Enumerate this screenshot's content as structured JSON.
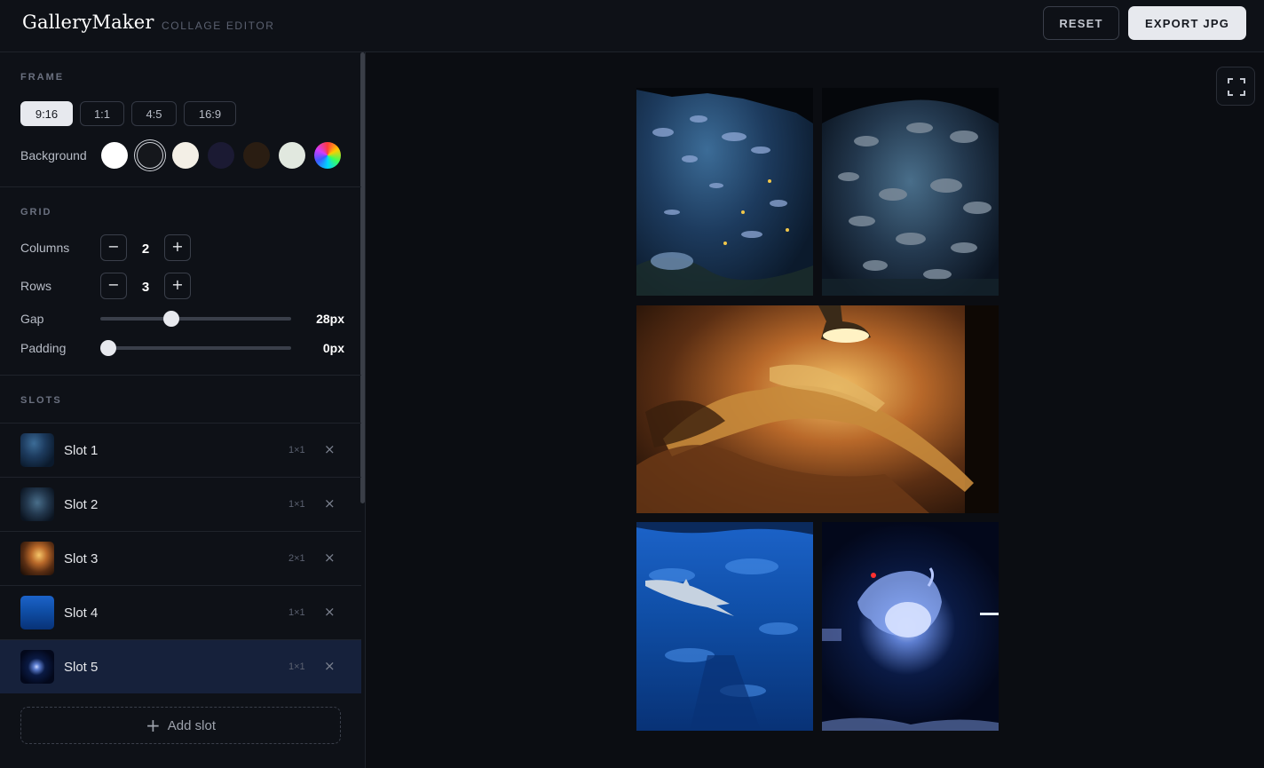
{
  "app": {
    "name": "GalleryMaker",
    "subtitle": "COLLAGE EDITOR",
    "reset_label": "RESET",
    "export_label": "EXPORT JPG"
  },
  "frame": {
    "title": "FRAME",
    "ratios": [
      "9:16",
      "1:1",
      "4:5",
      "16:9"
    ],
    "selected_ratio": "9:16",
    "background_label": "Background",
    "swatches": [
      "#ffffff",
      "#15171c",
      "#f3efe6",
      "#1b1a33",
      "#2a1d12",
      "#e1e8df",
      "conic-rainbow"
    ],
    "selected_swatch": "#15171c"
  },
  "grid": {
    "title": "GRID",
    "columns_label": "Columns",
    "columns_value": "2",
    "rows_label": "Rows",
    "rows_value": "3",
    "gap_label": "Gap",
    "gap_value": "28px",
    "gap_fraction": 0.36,
    "padding_label": "Padding",
    "padding_value": "0px",
    "padding_fraction": 0.0,
    "minus_glyph": "−",
    "plus_glyph": "+"
  },
  "slots": {
    "title": "SLOTS",
    "items": [
      {
        "name": "Slot 1",
        "size": "1×1"
      },
      {
        "name": "Slot 2",
        "size": "1×1"
      },
      {
        "name": "Slot 3",
        "size": "2×1"
      },
      {
        "name": "Slot 4",
        "size": "1×1"
      },
      {
        "name": "Slot 5",
        "size": "1×1",
        "selected": true
      }
    ],
    "remove_glyph": "×",
    "add_label": "Add slot",
    "add_glyph": "+"
  },
  "colors": {
    "accent_selected_row": "#16213b",
    "header_bg": "#0e1117",
    "canvas_bg": "#0b0d12"
  },
  "icons": {
    "fullscreen": "fullscreen-icon",
    "minus": "minus-icon",
    "plus": "plus-icon",
    "close": "close-icon"
  }
}
